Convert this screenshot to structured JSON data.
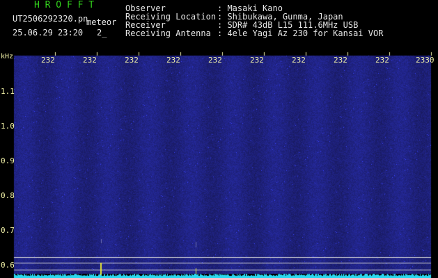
{
  "header": {
    "program_title": "H R O F F T",
    "filename": "UT2506292320.pn",
    "mode": "meteor",
    "date_time": "25.06.29 23:20",
    "counter": "2_",
    "observer_label": "Observer",
    "observer_value": ": Masaki Kano",
    "location_label": "Receiving Location",
    "location_value": ": Shibukawa, Gunma, Japan",
    "receiver_label": "Receiver",
    "receiver_value": ": SDR# 43dB L15 111.6MHz USB",
    "antenna_label": "Receiving Antenna",
    "antenna_value": ": 4ele Yagi Az 230 for Kansai VOR"
  },
  "axes": {
    "y_unit": "kHz",
    "y_ticks": [
      "1.1",
      "1.0",
      "0.9",
      "0.8",
      "0.7",
      "0.6"
    ],
    "x_ticks": [
      "232",
      "232",
      "232",
      "232",
      "232",
      "232",
      "232",
      "232",
      "232",
      "2330"
    ]
  },
  "colors": {
    "background": "#000000",
    "noise_base": "#1a1f8c",
    "trace": "#2ad8f0",
    "marker": "#e5e535",
    "header_green": "#32d21c"
  }
}
